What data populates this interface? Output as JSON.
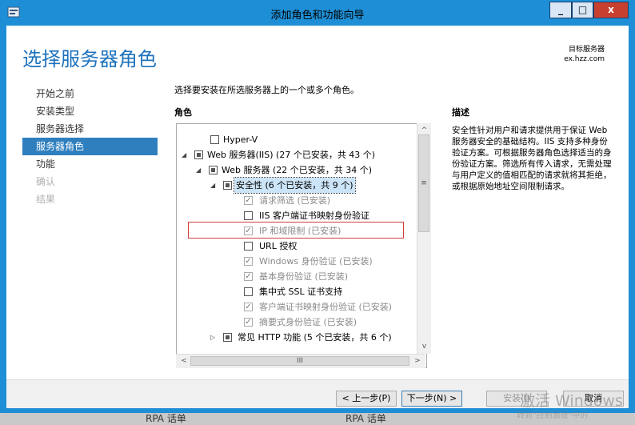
{
  "window": {
    "title": "添加角色和功能向导",
    "minimize": "_",
    "maximize": "□",
    "close": "x"
  },
  "page_title": "选择服务器角色",
  "destination": {
    "label": "目标服务器",
    "server": "ex.hzz.com"
  },
  "nav": {
    "items": [
      {
        "label": "开始之前",
        "state": "normal"
      },
      {
        "label": "安装类型",
        "state": "normal"
      },
      {
        "label": "服务器选择",
        "state": "normal"
      },
      {
        "label": "服务器角色",
        "state": "active"
      },
      {
        "label": "功能",
        "state": "normal"
      },
      {
        "label": "确认",
        "state": "disabled"
      },
      {
        "label": "结果",
        "state": "disabled"
      }
    ]
  },
  "instruction": "选择要安装在所选服务器上的一个或多个角色。",
  "roles_header": "角色",
  "description_header": "描述",
  "description": "安全性针对用户和请求提供用于保证 Web 服务器安全的基础结构。IIS 支持多种身份验证方案。可根据服务器角色选择适当的身份验证方案。筛选所有传入请求，无需处理与用户定义的值相匹配的请求就将其拒绝，或根据原始地址空间限制请求。",
  "tree": [
    {
      "label": "Hyper-V",
      "check": "none",
      "expander": "",
      "dim": false
    },
    {
      "label": "Web 服务器(IIS) (27 个已安装，共 43 个)",
      "check": "partial",
      "expander": "◢",
      "dim": false
    },
    {
      "label": "Web 服务器 (22 个已安装，共 34 个)",
      "check": "partial",
      "expander": "◢",
      "dim": false
    },
    {
      "label": "安全性 (6 个已安装，共 9 个)",
      "check": "partial",
      "expander": "◢",
      "dim": false,
      "selected": true
    },
    {
      "label": "请求筛选 (已安装)",
      "check": "checked",
      "expander": "",
      "dim": true
    },
    {
      "label": "IIS 客户端证书映射身份验证",
      "check": "none",
      "expander": "",
      "dim": false
    },
    {
      "label": "IP 和域限制 (已安装)",
      "check": "checked",
      "expander": "",
      "dim": true
    },
    {
      "label": "URL 授权",
      "check": "none",
      "expander": "",
      "dim": false
    },
    {
      "label": "Windows 身份验证 (已安装)",
      "check": "checked",
      "expander": "",
      "dim": true
    },
    {
      "label": "基本身份验证 (已安装)",
      "check": "checked",
      "expander": "",
      "dim": true
    },
    {
      "label": "集中式 SSL 证书支持",
      "check": "none",
      "expander": "",
      "dim": false
    },
    {
      "label": "客户端证书映射身份验证 (已安装)",
      "check": "checked",
      "expander": "",
      "dim": true
    },
    {
      "label": "摘要式身份验证 (已安装)",
      "check": "checked",
      "expander": "",
      "dim": true
    },
    {
      "label": "常见 HTTP 功能 (5 个已安装，共 6 个)",
      "check": "partial",
      "expander": "▷",
      "dim": false
    }
  ],
  "scroll": {
    "up": "^",
    "down": "v",
    "left": "<",
    "right": ">",
    "grip": "≡",
    "hgrip": "III"
  },
  "buttons": {
    "prev": "< 上一步(P)",
    "next": "下一步(N) >",
    "install": "安装(I)",
    "cancel": "取消"
  },
  "watermark": {
    "line1": "激活 Windows",
    "line2": "转到\"控制面板\"中的"
  },
  "behind_text": [
    "RPA 话单",
    "RPA 话单"
  ]
}
